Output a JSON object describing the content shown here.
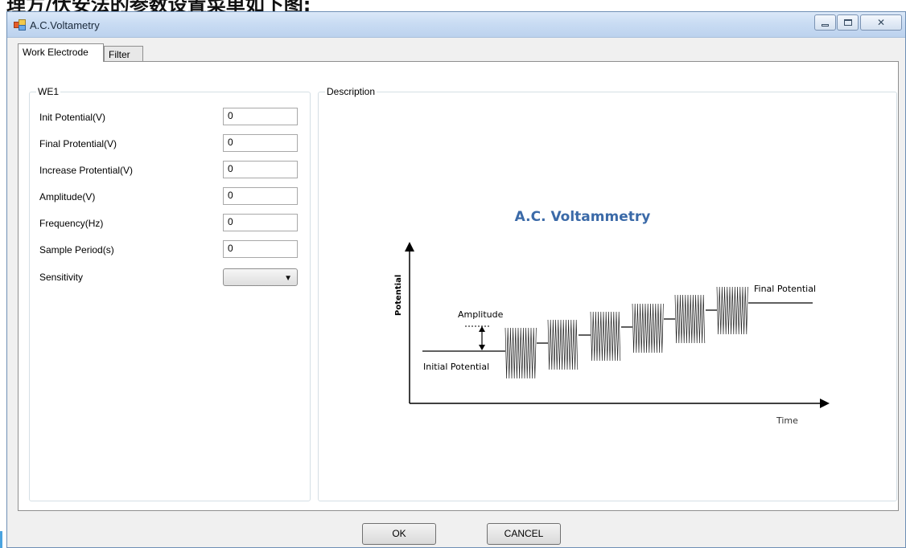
{
  "page_header": {
    "text": "理方/伏安法的参数设置菜单如下图:"
  },
  "window": {
    "title": "A.C.Voltametry",
    "icon": "app-form-icon",
    "buttons": {
      "minimize": "minimize-icon",
      "maximize": "maximize-icon",
      "close": "close-icon"
    }
  },
  "tabs": [
    {
      "label": "Work Electrode",
      "selected": true
    },
    {
      "label": "Filter",
      "selected": false
    }
  ],
  "we1": {
    "legend": "WE1",
    "fields": [
      {
        "label": "Init Potential(V)",
        "value": "0"
      },
      {
        "label": "Final Protential(V)",
        "value": "0"
      },
      {
        "label": "Increase Protential(V)",
        "value": "0"
      },
      {
        "label": "Amplitude(V)",
        "value": "0"
      },
      {
        "label": "Frequency(Hz)",
        "value": "0"
      },
      {
        "label": "Sample Period(s)",
        "value": "0"
      }
    ],
    "sensitivity": {
      "label": "Sensitivity",
      "value": ""
    }
  },
  "description": {
    "legend": "Description",
    "diagram": {
      "title": "A.C. Voltammetry",
      "y_label": "Potential",
      "x_label": "Time",
      "amplitude_label": "Amplitude",
      "initial_label": "Initial Potential",
      "final_label": "Final Potential",
      "colors": {
        "title": "#3b6aa8",
        "line": "#000000"
      }
    }
  },
  "buttons": {
    "ok": "OK",
    "cancel": "CANCEL"
  }
}
